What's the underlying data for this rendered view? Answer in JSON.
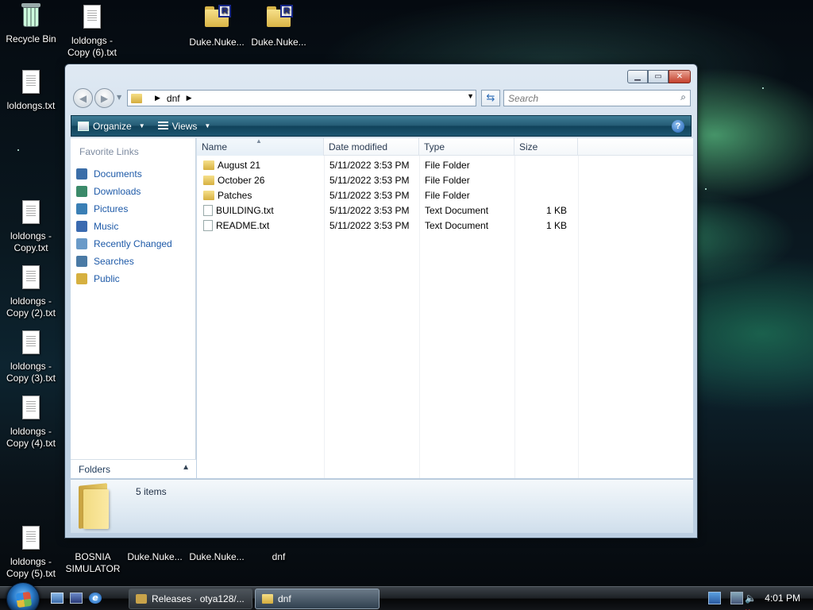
{
  "desktop": {
    "icons_left": [
      {
        "label": "Recycle Bin",
        "kind": "bin"
      },
      {
        "label": "loldongs.txt",
        "kind": "txt"
      },
      {
        "label": "loldongs - Copy.txt",
        "kind": "txt"
      },
      {
        "label": "loldongs - Copy (2).txt",
        "kind": "txt"
      },
      {
        "label": "loldongs - Copy (3).txt",
        "kind": "txt"
      },
      {
        "label": "loldongs - Copy (4).txt",
        "kind": "txt"
      },
      {
        "label": "loldongs - Copy (5).txt",
        "kind": "txt"
      }
    ],
    "icons_top": [
      {
        "label": "loldongs - Copy (6).txt",
        "kind": "txt"
      },
      {
        "label": "Duke.Nuke...",
        "kind": "rfile"
      },
      {
        "label": "Duke.Nuke...",
        "kind": "rfile"
      }
    ],
    "icons_bottom": [
      {
        "label": "BOSNIA SIMULATOR",
        "kind": "app"
      },
      {
        "label": "Duke.Nuke...",
        "kind": "folder"
      },
      {
        "label": "Duke.Nuke...",
        "kind": "folder"
      },
      {
        "label": "dnf",
        "kind": "folder"
      }
    ]
  },
  "window": {
    "address": {
      "folder": "dnf"
    },
    "search_placeholder": "Search",
    "toolbar": {
      "organize": "Organize",
      "views": "Views",
      "help": "?"
    },
    "nav": {
      "title": "Favorite Links",
      "items": [
        {
          "label": "Documents",
          "color": "#3b6ea8"
        },
        {
          "label": "Downloads",
          "color": "#3b8a6a"
        },
        {
          "label": "Pictures",
          "color": "#3a7fb5"
        },
        {
          "label": "Music",
          "color": "#3a6ab0"
        },
        {
          "label": "Recently Changed",
          "color": "#6a9ac8"
        },
        {
          "label": "Searches",
          "color": "#4a7aa5"
        },
        {
          "label": "Public",
          "color": "#d6b040"
        }
      ],
      "folders_label": "Folders"
    },
    "columns": [
      "Name",
      "Date modified",
      "Type",
      "Size"
    ],
    "rows": [
      {
        "name": "August 21",
        "date": "5/11/2022 3:53 PM",
        "type": "File Folder",
        "size": "",
        "kind": "folder"
      },
      {
        "name": "October 26",
        "date": "5/11/2022 3:53 PM",
        "type": "File Folder",
        "size": "",
        "kind": "folder"
      },
      {
        "name": "Patches",
        "date": "5/11/2022 3:53 PM",
        "type": "File Folder",
        "size": "",
        "kind": "folder"
      },
      {
        "name": "BUILDING.txt",
        "date": "5/11/2022 3:53 PM",
        "type": "Text Document",
        "size": "1 KB",
        "kind": "txt"
      },
      {
        "name": "README.txt",
        "date": "5/11/2022 3:53 PM",
        "type": "Text Document",
        "size": "1 KB",
        "kind": "txt"
      }
    ],
    "details": {
      "count": "5 items"
    }
  },
  "taskbar": {
    "tasks": [
      {
        "label": "Releases · otya128/...",
        "active": false
      },
      {
        "label": "dnf",
        "active": true
      }
    ],
    "clock": "4:01 PM"
  }
}
